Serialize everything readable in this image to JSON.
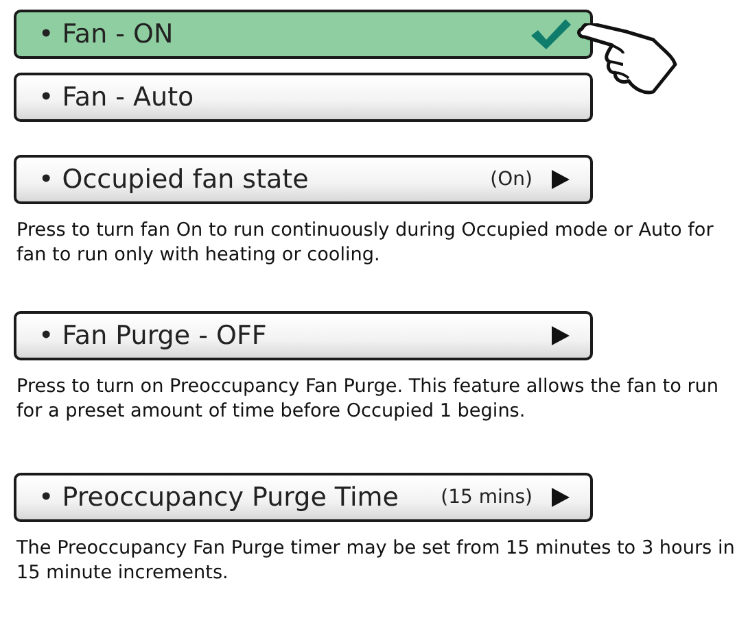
{
  "options": [
    {
      "label": "• Fan - ON",
      "selected": true
    },
    {
      "label": "• Fan - Auto",
      "selected": false
    }
  ],
  "settings": [
    {
      "label": "• Occupied fan state",
      "value": "(On)",
      "description": "Press to turn fan On to run continuously during Occupied mode or Auto for fan to run only with heating or cooling."
    },
    {
      "label": "• Fan Purge - OFF",
      "description": "Press to turn on Preoccupancy Fan Purge.  This feature allows the fan to run for a preset amount of time before Occupied 1 begins."
    },
    {
      "label": "• Preoccupancy Purge Time",
      "value": "(15 mins)",
      "description": "The Preoccupancy Fan Purge timer may be set from 15 minutes to 3 hours in 15 minute increments."
    }
  ]
}
